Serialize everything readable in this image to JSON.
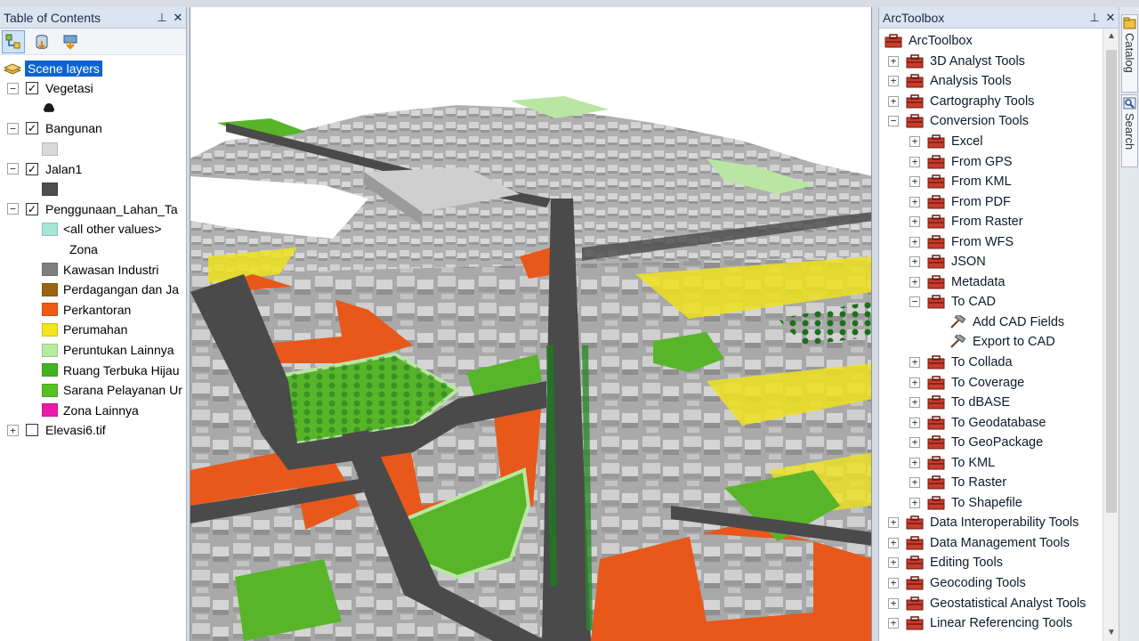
{
  "toc": {
    "title": "Table of Contents",
    "pin": "⊥",
    "close": "✕",
    "root": "Scene layers",
    "layers": [
      {
        "name": "Vegetasi",
        "checked": true,
        "symbol_color": "#1a1a1a",
        "symbol": "tree"
      },
      {
        "name": "Bangunan",
        "checked": true,
        "symbol_color": "#d9d9d9"
      },
      {
        "name": "Jalan1",
        "checked": true,
        "symbol_color": "#4d4d4d"
      },
      {
        "name": "Penggunaan_Lahan_Ta",
        "checked": true,
        "heading": "Zona",
        "classes": [
          {
            "label": "<all other values>",
            "color": "#a5e6d8"
          },
          {
            "label": "Kawasan Industri",
            "color": "#7f7f7f"
          },
          {
            "label": "Perdagangan dan Ja",
            "color": "#9c6410"
          },
          {
            "label": "Perkantoran",
            "color": "#f05a12"
          },
          {
            "label": "Perumahan",
            "color": "#f2e61c"
          },
          {
            "label": "Peruntukan Lainnya",
            "color": "#b9eba0"
          },
          {
            "label": "Ruang Terbuka Hijau",
            "color": "#3fb41e"
          },
          {
            "label": "Sarana Pelayanan Ur",
            "color": "#57c023"
          },
          {
            "label": "Zona Lainnya",
            "color": "#ea1aa8"
          }
        ]
      },
      {
        "name": "Elevasi6.tif",
        "checked": false
      }
    ]
  },
  "toolbox": {
    "title": "ArcToolbox",
    "pin": "⊥",
    "close": "✕",
    "root": "ArcToolbox",
    "items": [
      {
        "label": "3D Analyst Tools",
        "level": 0,
        "exp": "+"
      },
      {
        "label": "Analysis Tools",
        "level": 0,
        "exp": "+"
      },
      {
        "label": "Cartography Tools",
        "level": 0,
        "exp": "+"
      },
      {
        "label": "Conversion Tools",
        "level": 0,
        "exp": "−"
      },
      {
        "label": "Excel",
        "level": 1,
        "exp": "+"
      },
      {
        "label": "From GPS",
        "level": 1,
        "exp": "+"
      },
      {
        "label": "From KML",
        "level": 1,
        "exp": "+"
      },
      {
        "label": "From PDF",
        "level": 1,
        "exp": "+"
      },
      {
        "label": "From Raster",
        "level": 1,
        "exp": "+"
      },
      {
        "label": "From WFS",
        "level": 1,
        "exp": "+"
      },
      {
        "label": "JSON",
        "level": 1,
        "exp": "+"
      },
      {
        "label": "Metadata",
        "level": 1,
        "exp": "+"
      },
      {
        "label": "To CAD",
        "level": 1,
        "exp": "−"
      },
      {
        "label": "Add CAD Fields",
        "level": 2,
        "exp": "",
        "tool": true
      },
      {
        "label": "Export to CAD",
        "level": 2,
        "exp": "",
        "tool": true
      },
      {
        "label": "To Collada",
        "level": 1,
        "exp": "+"
      },
      {
        "label": "To Coverage",
        "level": 1,
        "exp": "+"
      },
      {
        "label": "To dBASE",
        "level": 1,
        "exp": "+"
      },
      {
        "label": "To Geodatabase",
        "level": 1,
        "exp": "+"
      },
      {
        "label": "To GeoPackage",
        "level": 1,
        "exp": "+"
      },
      {
        "label": "To KML",
        "level": 1,
        "exp": "+"
      },
      {
        "label": "To Raster",
        "level": 1,
        "exp": "+"
      },
      {
        "label": "To Shapefile",
        "level": 1,
        "exp": "+"
      },
      {
        "label": "Data Interoperability Tools",
        "level": 0,
        "exp": "+"
      },
      {
        "label": "Data Management Tools",
        "level": 0,
        "exp": "+"
      },
      {
        "label": "Editing Tools",
        "level": 0,
        "exp": "+"
      },
      {
        "label": "Geocoding Tools",
        "level": 0,
        "exp": "+"
      },
      {
        "label": "Geostatistical Analyst Tools",
        "level": 0,
        "exp": "+"
      },
      {
        "label": "Linear Referencing Tools",
        "level": 0,
        "exp": "+"
      }
    ]
  },
  "dock": {
    "catalog": "Catalog",
    "search": "Search"
  },
  "colors": {
    "road": "#4a4a4a",
    "building": "#c8c8c8",
    "office": "#e8581a",
    "housing": "#eee21e",
    "green": "#58b52a",
    "light_green": "#b9e7a3",
    "toolbox_red": "#c83c2c"
  }
}
